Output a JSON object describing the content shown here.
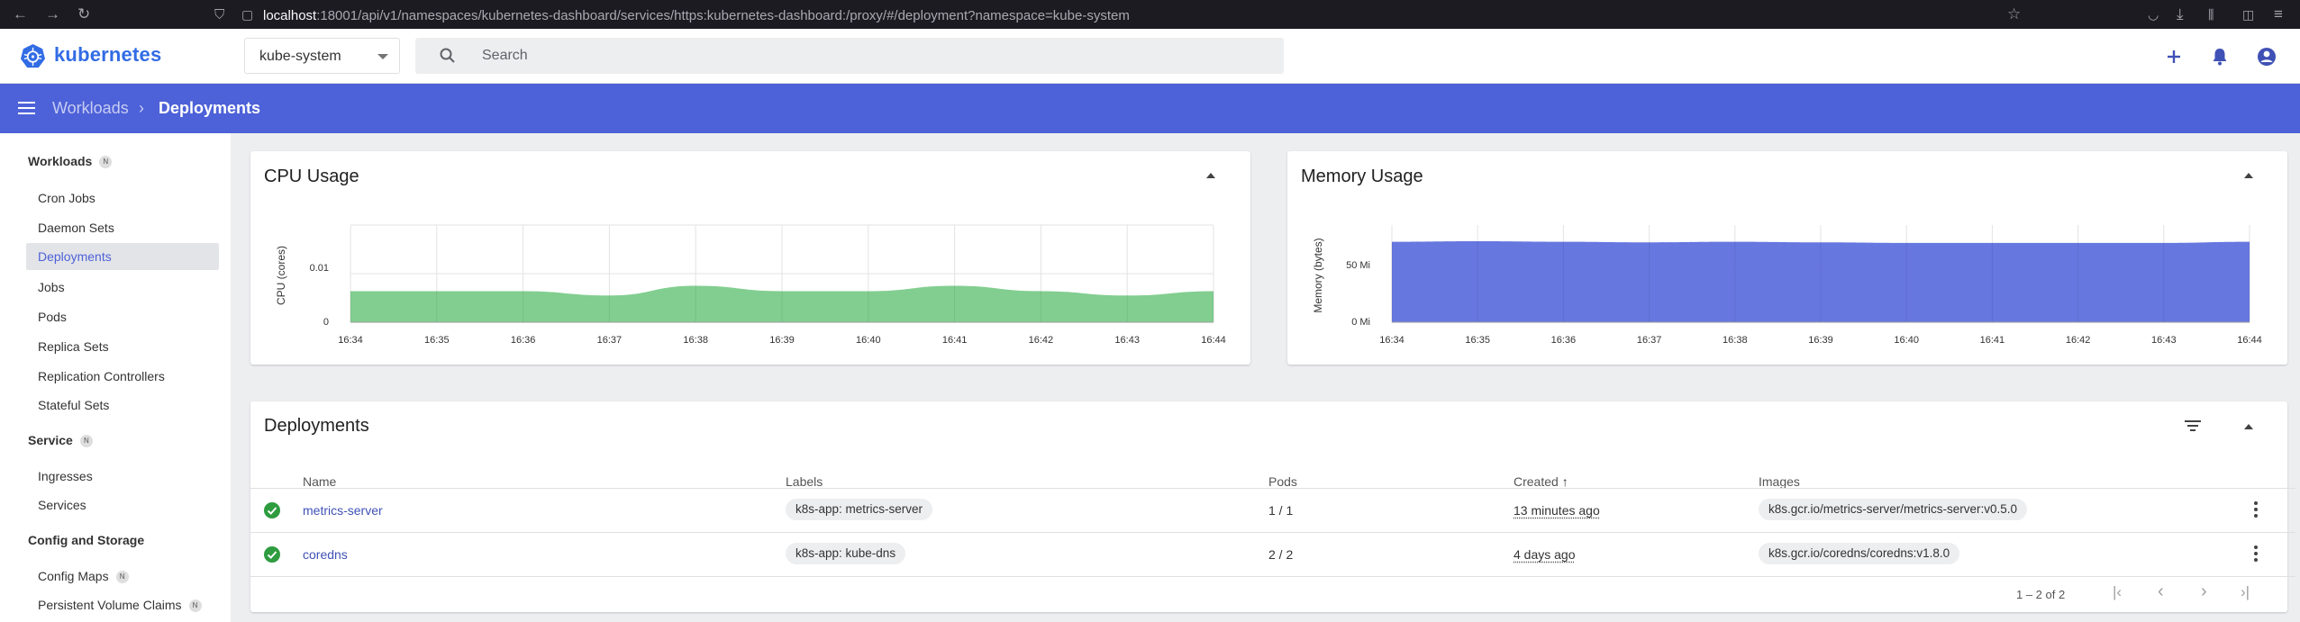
{
  "browser": {
    "url_host": "localhost",
    "url_rest": ":18001/api/v1/namespaces/kubernetes-dashboard/services/https:kubernetes-dashboard:/proxy/#/deployment?namespace=kube-system"
  },
  "header": {
    "logo_text": "kubernetes",
    "namespace": "kube-system",
    "search_placeholder": "Search"
  },
  "toolbar": {
    "breadcrumb_parent": "Workloads",
    "breadcrumb_sep": "›",
    "breadcrumb_current": "Deployments"
  },
  "sidebar": {
    "sections": [
      {
        "label": "Workloads",
        "badge": "N"
      },
      {
        "label": "Service",
        "badge": "N"
      },
      {
        "label": "Config and Storage",
        "badge": ""
      }
    ],
    "items": [
      {
        "label": "Cron Jobs"
      },
      {
        "label": "Daemon Sets"
      },
      {
        "label": "Deployments"
      },
      {
        "label": "Jobs"
      },
      {
        "label": "Pods"
      },
      {
        "label": "Replica Sets"
      },
      {
        "label": "Replication Controllers"
      },
      {
        "label": "Stateful Sets"
      },
      {
        "label": "Ingresses"
      },
      {
        "label": "Services"
      },
      {
        "label": "Config Maps",
        "badge": "N"
      },
      {
        "label": "Persistent Volume Claims",
        "badge": "N"
      }
    ],
    "active_item": "Deployments"
  },
  "cpu_chart": {
    "title": "CPU Usage",
    "ylabel": "CPU (cores)",
    "yticks": [
      "0",
      "0.01"
    ]
  },
  "memory_chart": {
    "title": "Memory Usage",
    "ylabel": "Memory (bytes)",
    "yticks": [
      "0 Mi",
      "50 Mi"
    ]
  },
  "chart_data": [
    {
      "type": "area",
      "title": "CPU Usage",
      "ylabel": "CPU (cores)",
      "x": [
        "16:34",
        "16:35",
        "16:36",
        "16:37",
        "16:38",
        "16:39",
        "16:40",
        "16:41",
        "16:42",
        "16:43",
        "16:44"
      ],
      "values": [
        0.0064,
        0.0064,
        0.0064,
        0.0055,
        0.0075,
        0.0064,
        0.0064,
        0.0075,
        0.0064,
        0.0055,
        0.0064
      ],
      "ylim": [
        0,
        0.02
      ],
      "color": "#6cc67c",
      "grid": true
    },
    {
      "type": "area",
      "title": "Memory Usage",
      "ylabel": "Memory (bytes)",
      "x": [
        "16:34",
        "16:35",
        "16:36",
        "16:37",
        "16:38",
        "16:39",
        "16:40",
        "16:41",
        "16:42",
        "16:43",
        "16:44"
      ],
      "values": [
        72,
        72.5,
        72,
        71.5,
        72,
        71.5,
        71,
        71,
        71,
        71,
        72
      ],
      "units": "Mi",
      "ylim": [
        0,
        87
      ],
      "color": "#5568db",
      "grid": true
    }
  ],
  "deployments": {
    "title": "Deployments",
    "columns": {
      "name": "Name",
      "labels": "Labels",
      "pods": "Pods",
      "created": "Created",
      "created_sort": "↑",
      "images": "Images"
    },
    "rows": [
      {
        "name": "metrics-server",
        "label": "k8s-app: metrics-server",
        "pods": "1 / 1",
        "created": "13 minutes ago",
        "image": "k8s.gcr.io/metrics-server/metrics-server:v0.5.0"
      },
      {
        "name": "coredns",
        "label": "k8s-app: kube-dns",
        "pods": "2 / 2",
        "created": "4 days ago",
        "image": "k8s.gcr.io/coredns/coredns:v1.8.0"
      }
    ],
    "pagination": "1 – 2 of 2"
  },
  "colors": {
    "primary": "#4d61d8",
    "cpu": "#6cc67c",
    "memory": "#5568db",
    "success": "#2e9c3f"
  }
}
